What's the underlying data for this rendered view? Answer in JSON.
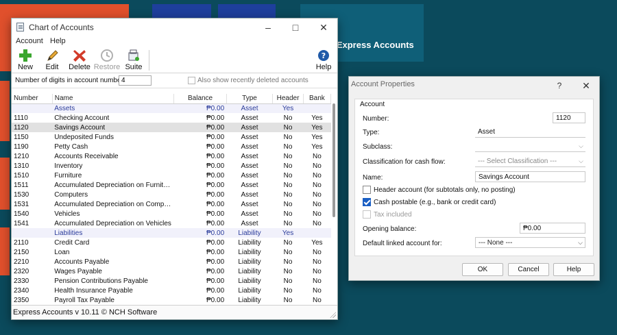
{
  "background": {
    "banner_text": "e Express Accounts"
  },
  "main_window": {
    "title": "Chart of Accounts",
    "menu": [
      "Account",
      "Help"
    ],
    "toolbar": {
      "new": "New",
      "edit": "Edit",
      "delete": "Delete",
      "restore": "Restore",
      "suite": "Suite",
      "help": "Help"
    },
    "digits_label": "Number of digits in account number:",
    "digits_value": "4",
    "show_deleted_label": "Also show recently deleted accounts",
    "columns": [
      "Number",
      "Name",
      "Balance",
      "Type",
      "Header",
      "Bank"
    ],
    "rows": [
      {
        "number": "",
        "name": "Assets",
        "balance": "₱0.00",
        "type": "Asset",
        "header": "Yes",
        "bank": "",
        "kind": "header"
      },
      {
        "number": "1110",
        "name": "Checking Account",
        "balance": "₱0.00",
        "type": "Asset",
        "header": "No",
        "bank": "Yes"
      },
      {
        "number": "1120",
        "name": "Savings Account",
        "balance": "₱0.00",
        "type": "Asset",
        "header": "No",
        "bank": "Yes",
        "kind": "selected"
      },
      {
        "number": "1150",
        "name": "Undeposited Funds",
        "balance": "₱0.00",
        "type": "Asset",
        "header": "No",
        "bank": "Yes"
      },
      {
        "number": "1190",
        "name": "Petty Cash",
        "balance": "₱0.00",
        "type": "Asset",
        "header": "No",
        "bank": "Yes"
      },
      {
        "number": "1210",
        "name": "Accounts Receivable",
        "balance": "₱0.00",
        "type": "Asset",
        "header": "No",
        "bank": "No"
      },
      {
        "number": "1310",
        "name": "Inventory",
        "balance": "₱0.00",
        "type": "Asset",
        "header": "No",
        "bank": "No"
      },
      {
        "number": "1510",
        "name": "Furniture",
        "balance": "₱0.00",
        "type": "Asset",
        "header": "No",
        "bank": "No"
      },
      {
        "number": "1511",
        "name": "Accumulated Depreciation on Furniture",
        "balance": "₱0.00",
        "type": "Asset",
        "header": "No",
        "bank": "No"
      },
      {
        "number": "1530",
        "name": "Computers",
        "balance": "₱0.00",
        "type": "Asset",
        "header": "No",
        "bank": "No"
      },
      {
        "number": "1531",
        "name": "Accumulated Depreciation on Comput...",
        "balance": "₱0.00",
        "type": "Asset",
        "header": "No",
        "bank": "No"
      },
      {
        "number": "1540",
        "name": "Vehicles",
        "balance": "₱0.00",
        "type": "Asset",
        "header": "No",
        "bank": "No"
      },
      {
        "number": "1541",
        "name": "Accumulated Depreciation on Vehicles",
        "balance": "₱0.00",
        "type": "Asset",
        "header": "No",
        "bank": "No"
      },
      {
        "number": "",
        "name": "Liabilities",
        "balance": "₱0.00",
        "type": "Liability",
        "header": "Yes",
        "bank": "",
        "kind": "header"
      },
      {
        "number": "2110",
        "name": "Credit Card",
        "balance": "₱0.00",
        "type": "Liability",
        "header": "No",
        "bank": "Yes"
      },
      {
        "number": "2150",
        "name": "Loan",
        "balance": "₱0.00",
        "type": "Liability",
        "header": "No",
        "bank": "No"
      },
      {
        "number": "2210",
        "name": "Accounts Payable",
        "balance": "₱0.00",
        "type": "Liability",
        "header": "No",
        "bank": "No"
      },
      {
        "number": "2320",
        "name": "Wages Payable",
        "balance": "₱0.00",
        "type": "Liability",
        "header": "No",
        "bank": "No"
      },
      {
        "number": "2330",
        "name": "Pension Contributions Payable",
        "balance": "₱0.00",
        "type": "Liability",
        "header": "No",
        "bank": "No"
      },
      {
        "number": "2340",
        "name": "Health Insurance Payable",
        "balance": "₱0.00",
        "type": "Liability",
        "header": "No",
        "bank": "No"
      },
      {
        "number": "2350",
        "name": "Payroll Tax Payable",
        "balance": "₱0.00",
        "type": "Liability",
        "header": "No",
        "bank": "No"
      }
    ],
    "status": "Express Accounts v 10.11 © NCH Software"
  },
  "dialog": {
    "title": "Account Properties",
    "help_glyph": "?",
    "group_label": "Account",
    "number_label": "Number:",
    "number_value": "1120",
    "type_label": "Type:",
    "type_value": "Asset",
    "subclass_label": "Subclass:",
    "subclass_value": "",
    "cashflow_label": "Classification for cash flow:",
    "cashflow_value": "---   Select Classification ---",
    "name_label": "Name:",
    "name_value": "Savings Account",
    "header_account_label": "Header account (for subtotals only, no posting)",
    "cash_postable_label": "Cash postable (e.g., bank or credit card)",
    "tax_included_label": "Tax included",
    "opening_balance_label": "Opening balance:",
    "opening_balance_value": "₱0.00",
    "linked_label": "Default linked account for:",
    "linked_value": "--- None ---",
    "ok": "OK",
    "cancel": "Cancel",
    "help": "Help"
  }
}
